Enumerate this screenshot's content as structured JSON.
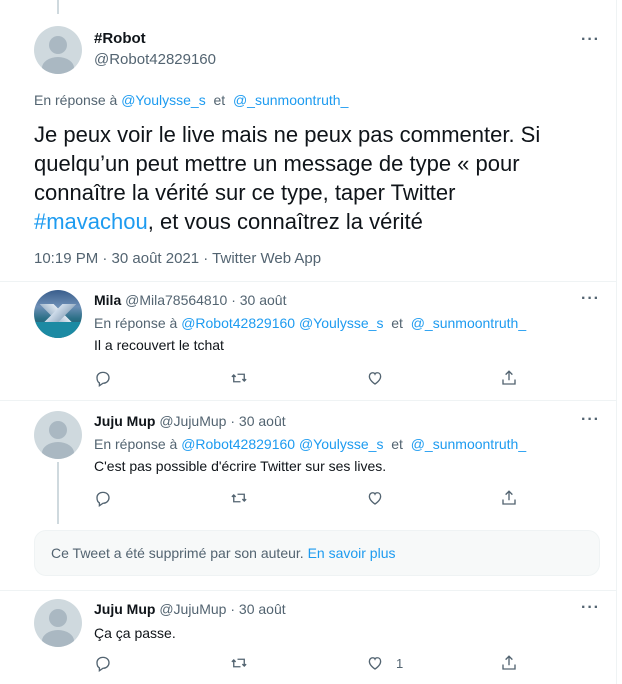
{
  "main_tweet": {
    "display_name": "#Robot",
    "handle": "@Robot42829160",
    "reply_prefix": "En réponse à",
    "reply_to_1": "@Youlysse_s",
    "reply_and": "et",
    "reply_to_2": "@_sunmoontruth_",
    "text_part1": "Je peux voir le live mais ne peux pas commenter. Si quelqu’un peut mettre un message de type « pour connaître la vérité sur ce type, taper Twitter ",
    "hashtag": "#mavachou",
    "text_part2": ", et vous connaîtrez la vérité",
    "meta": "10:19 PM · 30 août 2021 · Twitter Web App",
    "more": "···"
  },
  "replies": [
    {
      "display_name": "Mila",
      "handle": "@Mila78564810",
      "dot": "·",
      "date": "30 août",
      "reply_prefix": "En réponse à",
      "reply_to_1": "@Robot42829160",
      "reply_to_2": "@Youlysse_s",
      "reply_and": "et",
      "reply_to_3": "@_sunmoontruth_",
      "text": "Il a recouvert le tchat",
      "like_count": "",
      "more": "···"
    },
    {
      "display_name": "Juju Mup",
      "handle": "@JujuMup",
      "dot": "·",
      "date": "30 août",
      "reply_prefix": "En réponse à",
      "reply_to_1": "@Robot42829160",
      "reply_to_2": "@Youlysse_s",
      "reply_and": "et",
      "reply_to_3": "@_sunmoontruth_",
      "text": "C'est pas possible d'écrire Twitter sur ses lives.",
      "like_count": "",
      "more": "···"
    },
    {
      "display_name": "Juju Mup",
      "handle": "@JujuMup",
      "dot": "·",
      "date": "30 août",
      "text": "Ça ça passe.",
      "like_count": "1",
      "more": "···"
    }
  ],
  "deleted_notice": {
    "text": "Ce Tweet a été supprimé par son auteur.",
    "link": "En savoir plus"
  },
  "icons": [
    "reply-icon",
    "retweet-icon",
    "like-icon",
    "share-icon",
    "more-icon"
  ],
  "colors": {
    "link": "#1d9bf0",
    "muted": "#536471",
    "text": "#0f1419"
  }
}
